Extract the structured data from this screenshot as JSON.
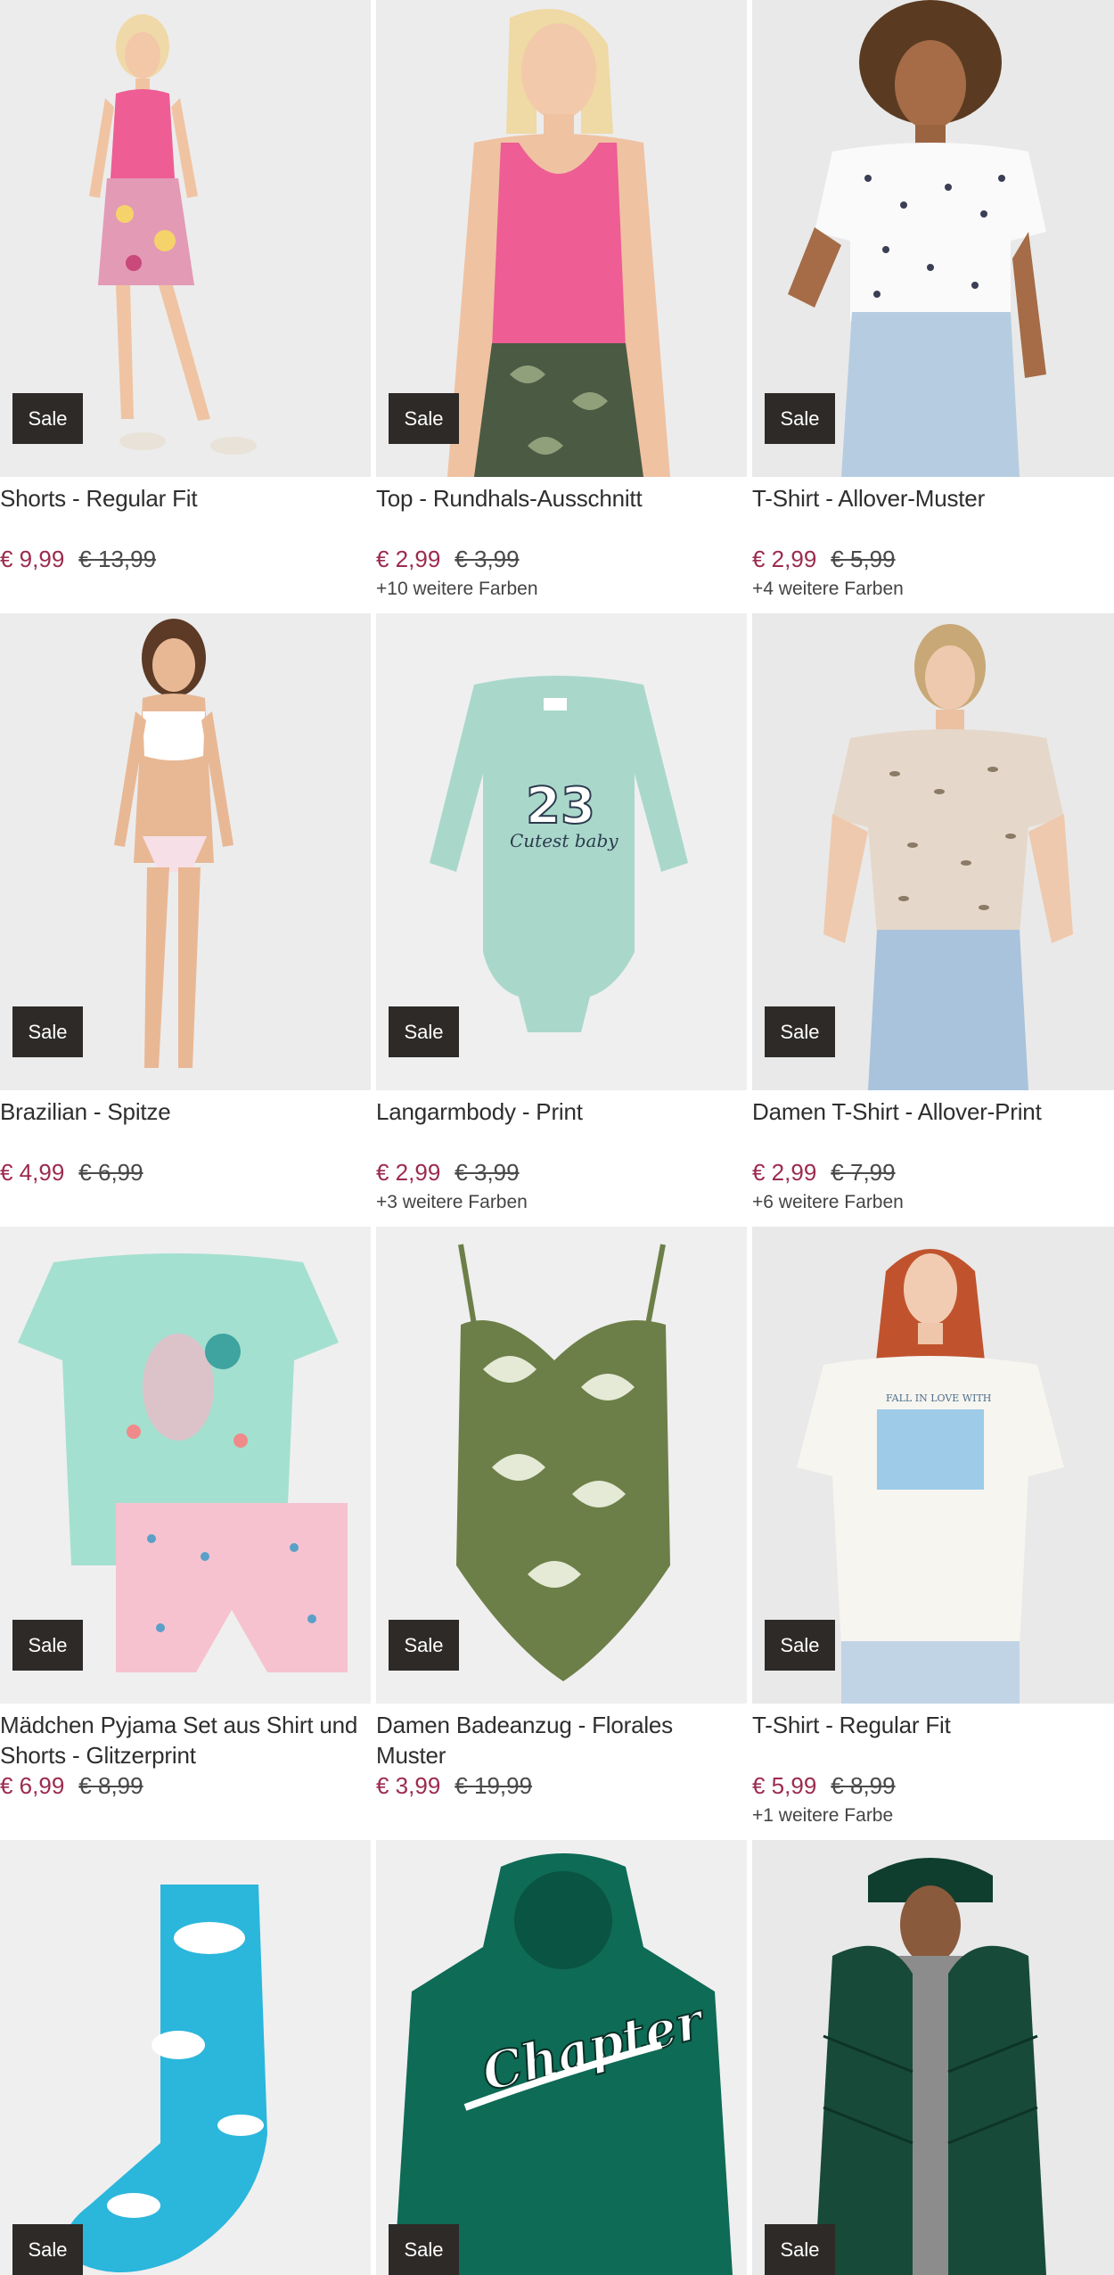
{
  "products": [
    {
      "badge": "Sale",
      "title": "Shorts - Regular Fit",
      "price": "€ 9,99",
      "old_price": "€ 13,99",
      "colors": ""
    },
    {
      "badge": "Sale",
      "title": "Top - Rundhals-Ausschnitt",
      "price": "€ 2,99",
      "old_price": "€ 3,99",
      "colors": "+10 weitere Farben"
    },
    {
      "badge": "Sale",
      "title": "T-Shirt - Allover-Muster",
      "price": "€ 2,99",
      "old_price": "€ 5,99",
      "colors": "+4 weitere Farben"
    },
    {
      "badge": "Sale",
      "title": "Brazilian - Spitze",
      "price": "€ 4,99",
      "old_price": "€ 6,99",
      "colors": ""
    },
    {
      "badge": "Sale",
      "title": "Langarmbody - Print",
      "price": "€ 2,99",
      "old_price": "€ 3,99",
      "colors": "+3 weitere Farben"
    },
    {
      "badge": "Sale",
      "title": "Damen T-Shirt - Allover-Print",
      "price": "€ 2,99",
      "old_price": "€ 7,99",
      "colors": "+6 weitere Farben"
    },
    {
      "badge": "Sale",
      "title": "Mädchen Pyjama Set aus Shirt und Shorts - Glitzerprint",
      "price": "€ 6,99",
      "old_price": "€ 8,99",
      "colors": ""
    },
    {
      "badge": "Sale",
      "title": "Damen Badeanzug - Florales Muster",
      "price": "€ 3,99",
      "old_price": "€ 19,99",
      "colors": ""
    },
    {
      "badge": "Sale",
      "title": "T-Shirt - Regular Fit",
      "price": "€ 5,99",
      "old_price": "€ 8,99",
      "colors": "+1 weitere Farbe"
    },
    {
      "badge": "Sale"
    },
    {
      "badge": "Sale"
    },
    {
      "badge": "Sale"
    }
  ],
  "colors": {
    "price_sale": "#9c2b4e",
    "badge_bg": "#2d2a28",
    "image_bg": "#efefef"
  }
}
